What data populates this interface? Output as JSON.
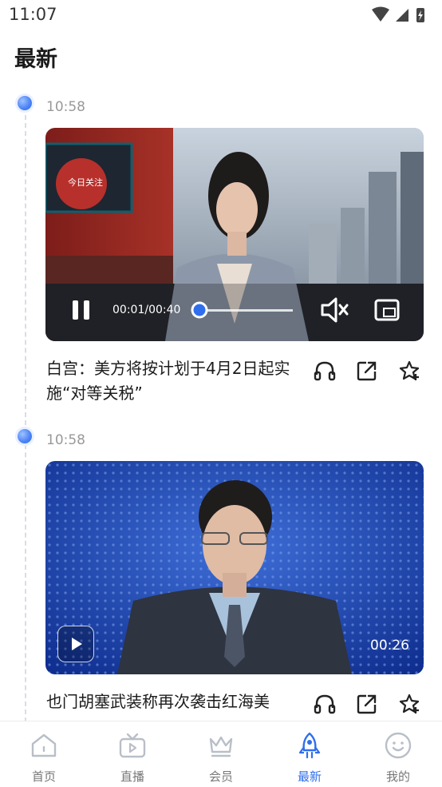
{
  "status_bar": {
    "time": "11:07"
  },
  "page_title": "最新",
  "feed": [
    {
      "time": "10:58",
      "title": "白宫：美方将按计划于4月2日起实施“对等关税”",
      "player": {
        "current": "00:01",
        "total": "00:40",
        "time_display": "00:01/00:40",
        "progress": 0.025,
        "playing": true,
        "muted": true
      }
    },
    {
      "time": "10:58",
      "title": "也门胡塞武装称再次袭击红海美",
      "player": {
        "duration": "00:26",
        "playing": false
      }
    }
  ],
  "tabbar": {
    "tabs": [
      {
        "label": "首页"
      },
      {
        "label": "直播"
      },
      {
        "label": "会员"
      },
      {
        "label": "最新"
      },
      {
        "label": "我的"
      }
    ],
    "active": "最新"
  },
  "colors": {
    "accent": "#2f6fee",
    "muted_text": "#999999",
    "progress": "#2f6fee"
  }
}
